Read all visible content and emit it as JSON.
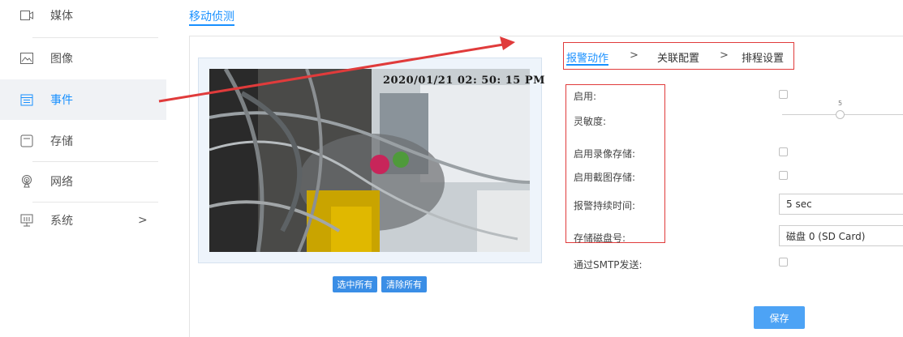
{
  "sidebar": {
    "items": [
      {
        "label": "媒体",
        "icon": "media-icon",
        "active": false
      },
      {
        "label": "图像",
        "icon": "image-icon",
        "active": false
      },
      {
        "label": "事件",
        "icon": "event-icon",
        "active": true
      },
      {
        "label": "存储",
        "icon": "storage-icon",
        "active": false
      },
      {
        "label": "网络",
        "icon": "network-icon",
        "active": false
      },
      {
        "label": "系统",
        "icon": "system-icon",
        "active": false,
        "chevron": ">"
      }
    ]
  },
  "page": {
    "title": "移动侦测"
  },
  "preview": {
    "timestamp": "2020/01/21 02: 50: 15 PM",
    "select_all": "选中所有",
    "clear_all": "清除所有"
  },
  "steps": {
    "items": [
      "报警动作",
      "关联配置",
      "排程设置"
    ],
    "separator": ">",
    "active_index": 0
  },
  "form": {
    "enable": {
      "label": "启用:",
      "checked": false
    },
    "sensitivity": {
      "label": "灵敏度:",
      "value": "5"
    },
    "record_storage": {
      "label": "启用录像存储:",
      "checked": false
    },
    "snapshot_storage": {
      "label": "启用截图存储:",
      "checked": false
    },
    "alarm_duration": {
      "label": "报警持续时间:",
      "value": "5 sec"
    },
    "storage_disk": {
      "label": "存储磁盘号:",
      "value": "磁盘 0 (SD Card)"
    },
    "smtp_send": {
      "label": "通过SMTP发送:",
      "checked": false
    }
  },
  "save_label": "保存",
  "colors": {
    "accent": "#1890ff",
    "annotation": "#e03b3b"
  }
}
